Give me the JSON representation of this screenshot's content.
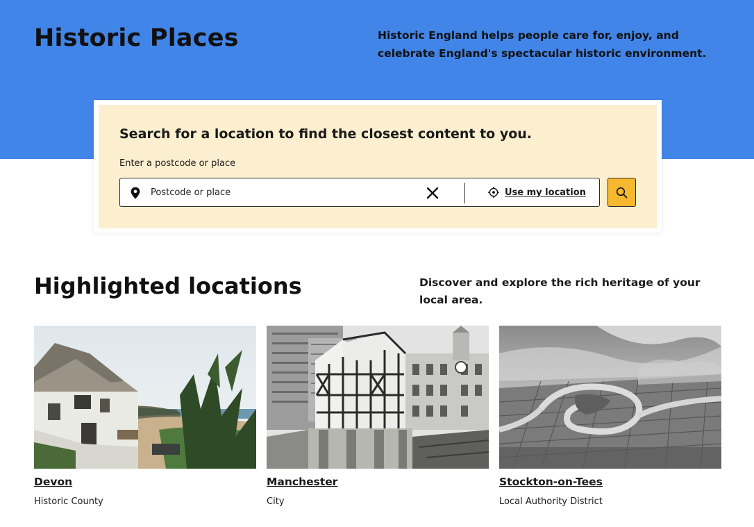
{
  "header": {
    "title": "Historic Places",
    "intro": "Historic England helps people care for, enjoy, and celebrate England's spectacular historic environment."
  },
  "search": {
    "heading": "Search for a location to find the closest content to you.",
    "label": "Enter a postcode or place",
    "placeholder": "Postcode or place",
    "value": "",
    "use_location_label": "Use my location"
  },
  "highlighted": {
    "title": "Highlighted locations",
    "intro": "Discover and explore the rich heritage of your local area.",
    "cards": [
      {
        "name": "Devon",
        "type": "Historic County"
      },
      {
        "name": "Manchester",
        "type": "City"
      },
      {
        "name": "Stockton-on-Tees",
        "type": "Local Authority District"
      }
    ]
  },
  "colors": {
    "hero_bg": "#4285e8",
    "panel_bg": "#fcefd0",
    "search_button": "#f5b82e"
  },
  "icons": {
    "pin": "map-pin-icon",
    "clear": "close-icon",
    "locate": "crosshair-icon",
    "search": "search-icon"
  }
}
